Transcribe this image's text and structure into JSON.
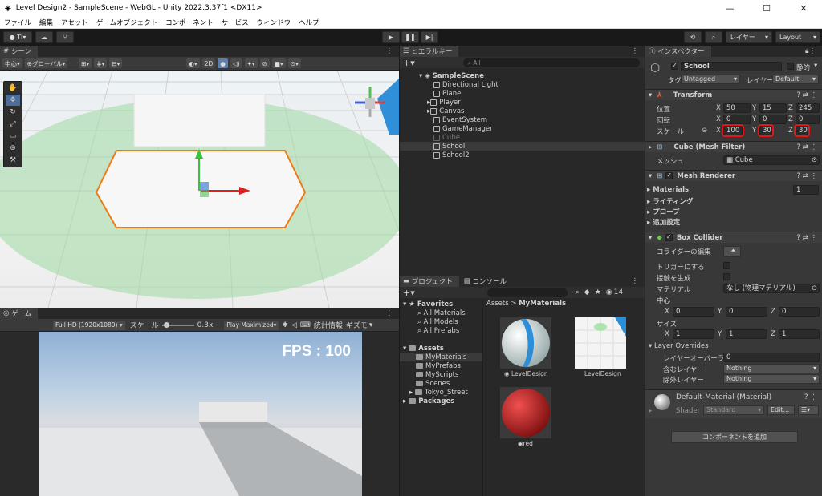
{
  "window": {
    "title": "Level Design2 - SampleScene - WebGL - Unity 2022.3.37f1 <DX11>",
    "min": "—",
    "max": "☐",
    "close": "✕"
  },
  "menu": [
    "ファイル",
    "編集",
    "アセット",
    "ゲームオブジェクト",
    "コンポーネント",
    "サービス",
    "ウィンドウ",
    "ヘルプ"
  ],
  "toolbar": {
    "account": "TI",
    "layers": "レイヤー",
    "layout": "Layout"
  },
  "scene": {
    "tab": "シーン",
    "pivot": "中心",
    "global": "グローバル",
    "mode2d": "2D"
  },
  "game": {
    "tab": "ゲーム",
    "resolution": "Full HD (1920x1080)",
    "scale_label": "スケール",
    "scale_value": "0.3x",
    "play_mode": "Play Maximized",
    "stats": "統計情報",
    "gizmos": "ギズモ",
    "fps": "FPS : 100"
  },
  "hierarchy": {
    "tab": "ヒエラルキー",
    "search": "All",
    "scene": "SampleScene",
    "items": [
      "Directional Light",
      "Plane",
      "Player",
      "Canvas",
      "EventSystem",
      "GameManager",
      "Cube",
      "School",
      "School2"
    ]
  },
  "project": {
    "tab": "プロジェクト",
    "console_tab": "コンソール",
    "count": "14",
    "favorites": "Favorites",
    "fav_items": [
      "All Materials",
      "All Models",
      "All Prefabs"
    ],
    "assets": "Assets",
    "asset_folders": [
      "MyMaterials",
      "MyPrefabs",
      "MyScripts",
      "Scenes",
      "Tokyo_Street"
    ],
    "packages": "Packages",
    "breadcrumb_root": "Assets",
    "breadcrumb_leaf": "MyMaterials",
    "thumbs": [
      "LevelDesign",
      "LevelDesign",
      "red"
    ]
  },
  "inspector": {
    "tab": "インスペクター",
    "object_name": "School",
    "static": "静的",
    "tag_label": "タグ",
    "tag": "Untagged",
    "layer_label": "レイヤー",
    "layer": "Default",
    "transform": "Transform",
    "position_label": "位置",
    "rotation_label": "回転",
    "scale_label": "スケール",
    "position": {
      "x": "50",
      "y": "15",
      "z": "245"
    },
    "rotation": {
      "x": "0",
      "y": "0",
      "z": "0"
    },
    "scale": {
      "x": "100",
      "y": "30",
      "z": "30"
    },
    "mesh_filter": "Cube (Mesh Filter)",
    "mesh_label": "メッシュ",
    "mesh": "Cube",
    "mesh_renderer": "Mesh Renderer",
    "materials": "Materials",
    "materials_count": "1",
    "lighting": "ライティング",
    "probes": "プローブ",
    "additional": "追加設定",
    "box_collider": "Box Collider",
    "edit_collider": "コライダーの編集",
    "is_trigger": "トリガーにする",
    "provides_contacts": "接触を生成",
    "material_label": "マテリアル",
    "material": "なし (物理マテリアル)",
    "center_label": "中心",
    "center": {
      "x": "0",
      "y": "0",
      "z": "0"
    },
    "size_label": "サイズ",
    "size": {
      "x": "1",
      "y": "1",
      "z": "1"
    },
    "layer_overrides": "Layer Overrides",
    "layer_override_priority": "レイヤーオーバーライド",
    "priority_value": "0",
    "include_layers": "含むレイヤー",
    "include_value": "Nothing",
    "exclude_layers": "除外レイヤー",
    "exclude_value": "Nothing",
    "default_material": "Default-Material (Material)",
    "shader_label": "Shader",
    "shader": "Standard",
    "edit": "Edit...",
    "add_component": "コンポーネントを追加",
    "axis": {
      "x": "X",
      "y": "Y",
      "z": "Z"
    }
  },
  "colors": {
    "selection_outline": "#f07a16",
    "highlight_box": "#e0181b",
    "panel_bg": "#383838"
  }
}
